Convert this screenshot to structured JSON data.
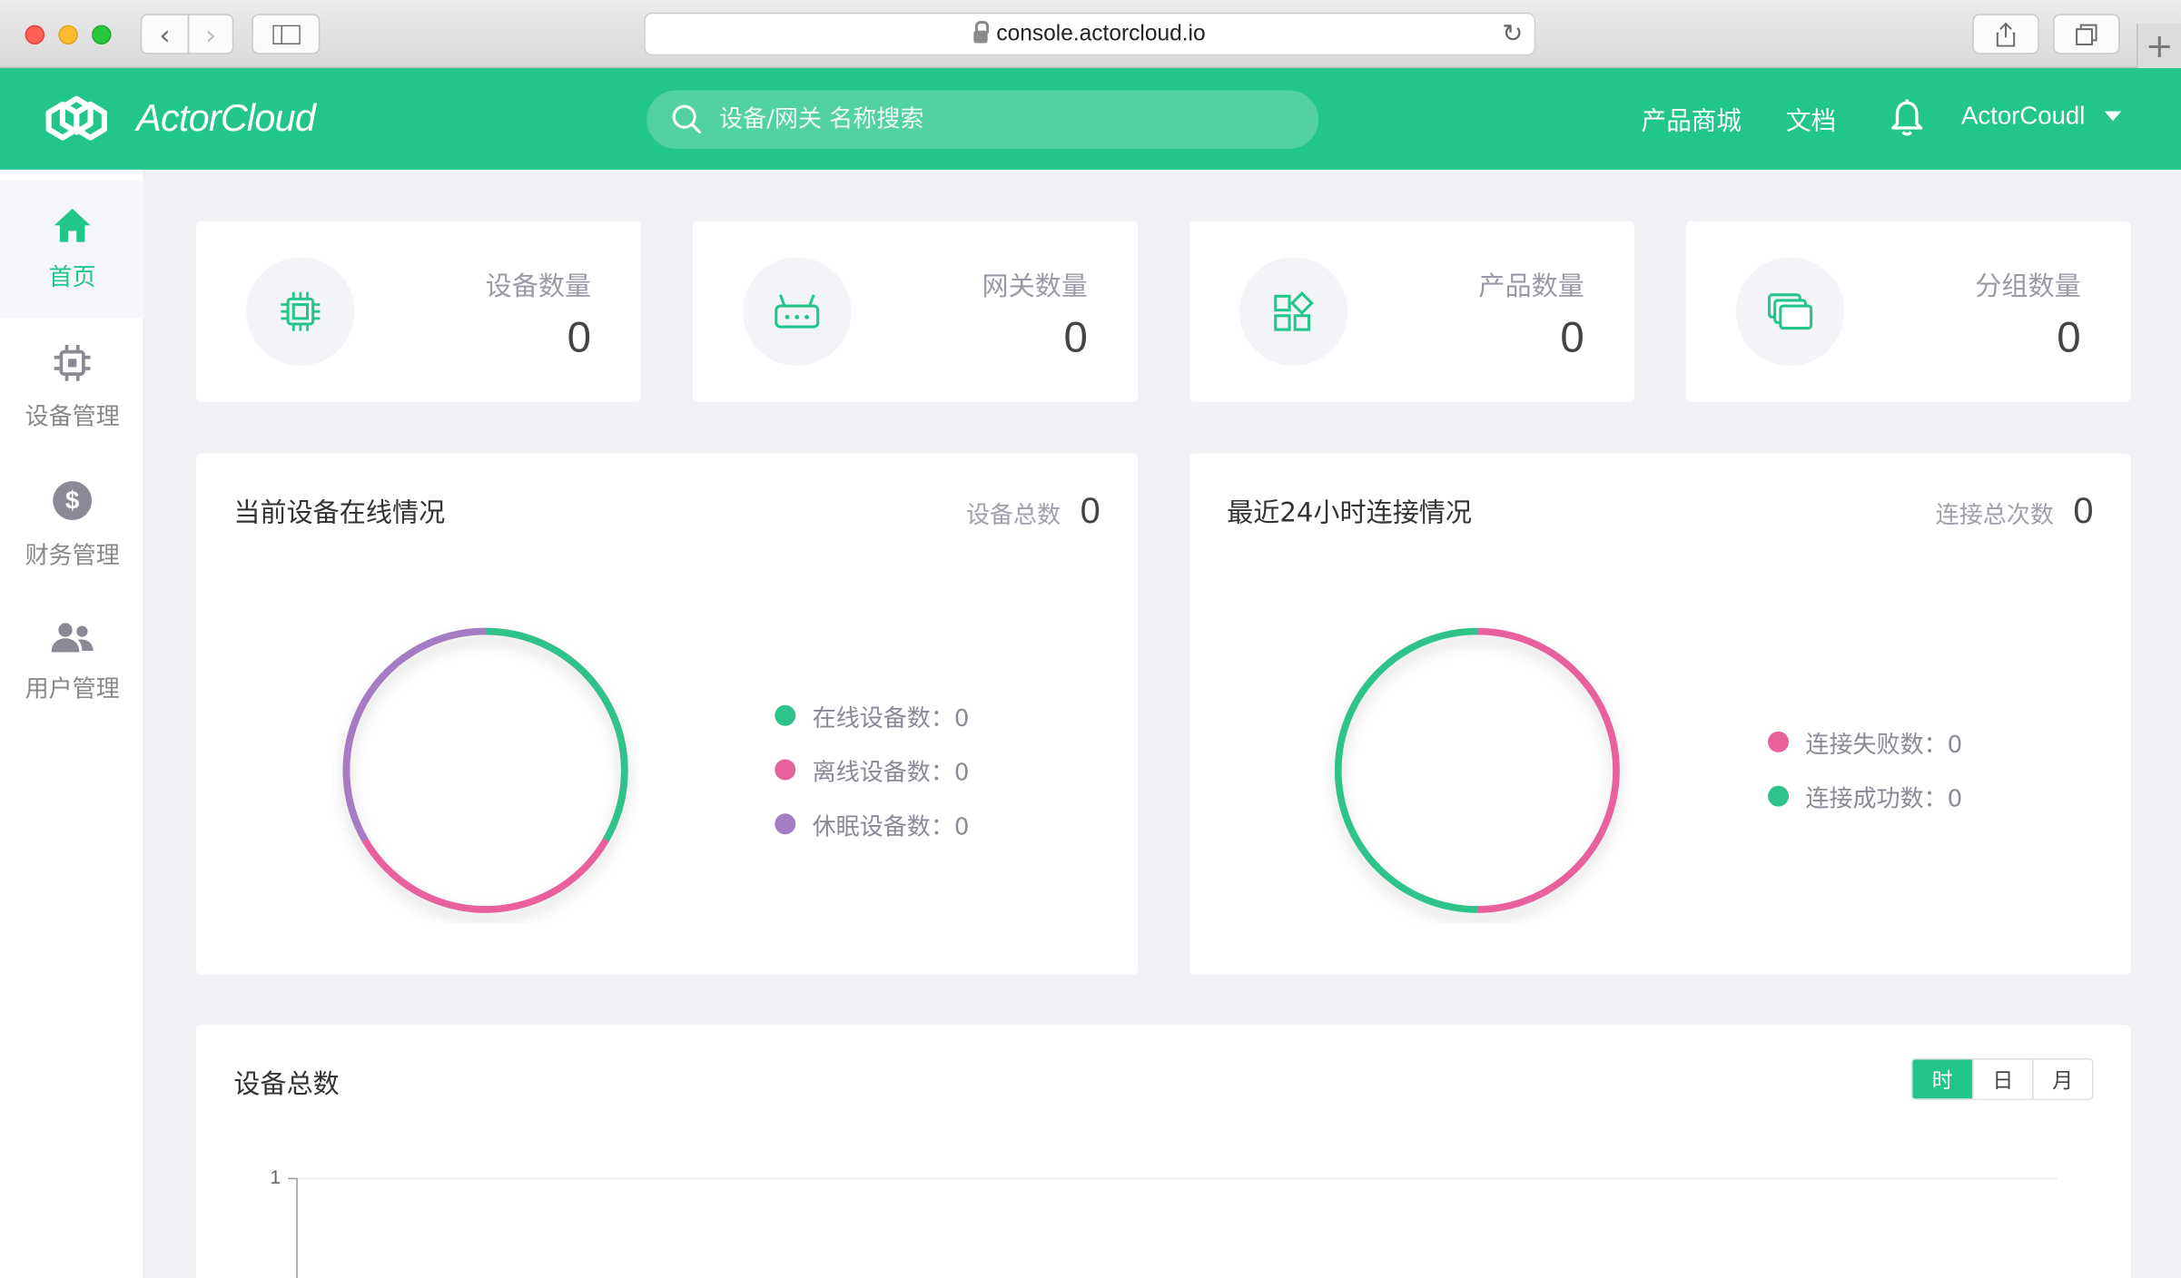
{
  "browser": {
    "url": "console.actorcloud.io"
  },
  "header": {
    "logo_text": "ActorCloud",
    "search_placeholder": "设备/网关 名称搜索",
    "nav": [
      "产品商城",
      "文档"
    ],
    "user_name": "ActorCoudl"
  },
  "sidebar": {
    "items": [
      {
        "label": "首页",
        "icon": "home-icon",
        "active": true
      },
      {
        "label": "设备管理",
        "icon": "chip-icon",
        "active": false
      },
      {
        "label": "财务管理",
        "icon": "dollar-icon",
        "active": false
      },
      {
        "label": "用户管理",
        "icon": "users-icon",
        "active": false
      }
    ]
  },
  "stats": [
    {
      "label": "设备数量",
      "value": "0",
      "icon": "chip-icon"
    },
    {
      "label": "网关数量",
      "value": "0",
      "icon": "gateway-icon"
    },
    {
      "label": "产品数量",
      "value": "0",
      "icon": "apps-icon"
    },
    {
      "label": "分组数量",
      "value": "0",
      "icon": "group-icon"
    }
  ],
  "online_panel": {
    "title": "当前设备在线情况",
    "meta_label": "设备总数",
    "meta_value": "0",
    "legend": [
      {
        "label": "在线设备数：0",
        "color": "#2ec38a"
      },
      {
        "label": "离线设备数：0",
        "color": "#e8619c"
      },
      {
        "label": "休眠设备数：0",
        "color": "#a47cc3"
      }
    ]
  },
  "connect_panel": {
    "title": "最近24小时连接情况",
    "meta_label": "连接总次数",
    "meta_value": "0",
    "legend": [
      {
        "label": "连接失败数：0",
        "color": "#e8619c"
      },
      {
        "label": "连接成功数：0",
        "color": "#2ec38a"
      }
    ]
  },
  "total_panel": {
    "title": "设备总数",
    "segments": [
      "时",
      "日",
      "月"
    ],
    "active_segment": "时",
    "y_tick": "1"
  }
}
